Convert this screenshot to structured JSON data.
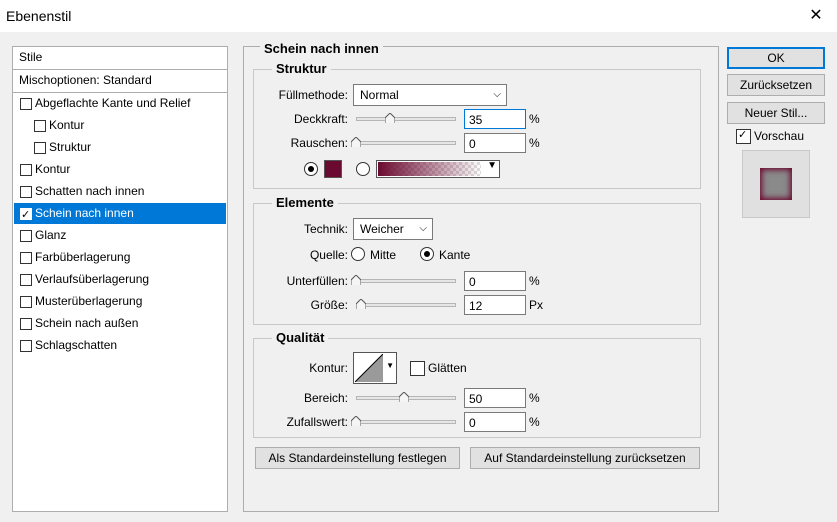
{
  "window": {
    "title": "Ebenenstil",
    "close_label": "✕"
  },
  "styles_panel": {
    "header": "Stile",
    "blend_options": "Mischoptionen: Standard",
    "items": [
      {
        "label": "Abgeflachte Kante und Relief",
        "checked": false,
        "indent": false,
        "selected": false
      },
      {
        "label": "Kontur",
        "checked": false,
        "indent": true,
        "selected": false
      },
      {
        "label": "Struktur",
        "checked": false,
        "indent": true,
        "selected": false
      },
      {
        "label": "Kontur",
        "checked": false,
        "indent": false,
        "selected": false
      },
      {
        "label": "Schatten nach innen",
        "checked": false,
        "indent": false,
        "selected": false
      },
      {
        "label": "Schein nach innen",
        "checked": true,
        "indent": false,
        "selected": true
      },
      {
        "label": "Glanz",
        "checked": false,
        "indent": false,
        "selected": false
      },
      {
        "label": "Farbüberlagerung",
        "checked": false,
        "indent": false,
        "selected": false
      },
      {
        "label": "Verlaufsüberlagerung",
        "checked": false,
        "indent": false,
        "selected": false
      },
      {
        "label": "Musterüberlagerung",
        "checked": false,
        "indent": false,
        "selected": false
      },
      {
        "label": "Schein nach außen",
        "checked": false,
        "indent": false,
        "selected": false
      },
      {
        "label": "Schlagschatten",
        "checked": false,
        "indent": false,
        "selected": false
      }
    ]
  },
  "main": {
    "section_title": "Schein nach innen",
    "struktur": {
      "title": "Struktur",
      "blend_mode_label": "Füllmethode:",
      "blend_mode_value": "Normal",
      "opacity_label": "Deckkraft:",
      "opacity_value": "35",
      "opacity_fraction": 0.35,
      "noise_label": "Rauschen:",
      "noise_value": "0",
      "noise_fraction": 0,
      "unit_percent": "%",
      "color": "#6b0a30"
    },
    "elemente": {
      "title": "Elemente",
      "technique_label": "Technik:",
      "technique_value": "Weicher",
      "source_label": "Quelle:",
      "source_center": "Mitte",
      "source_edge": "Kante",
      "choke_label": "Unterfüllen:",
      "choke_value": "0",
      "choke_fraction": 0,
      "size_label": "Größe:",
      "size_value": "12",
      "size_fraction": 0.05,
      "unit_px": "Px",
      "unit_percent": "%"
    },
    "qualitaet": {
      "title": "Qualität",
      "contour_label": "Kontur:",
      "antialias_label": "Glätten",
      "range_label": "Bereich:",
      "range_value": "50",
      "range_fraction": 0.5,
      "jitter_label": "Zufallswert:",
      "jitter_value": "0",
      "jitter_fraction": 0,
      "unit_percent": "%"
    },
    "make_default": "Als Standardeinstellung festlegen",
    "reset_default": "Auf Standardeinstellung zurücksetzen"
  },
  "actions": {
    "ok": "OK",
    "reset": "Zurücksetzen",
    "new_style": "Neuer Stil...",
    "preview_label": "Vorschau"
  }
}
